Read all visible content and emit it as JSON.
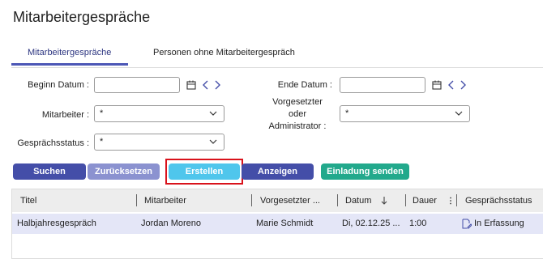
{
  "page": {
    "title": "Mitarbeitergespräche"
  },
  "tabs": [
    {
      "label": "Mitarbeitergespräche",
      "active": true
    },
    {
      "label": "Personen ohne Mitarbeitergespräch",
      "active": false
    }
  ],
  "filters": {
    "begin_date_label": "Beginn Datum :",
    "begin_date_value": "",
    "end_date_label": "Ende Datum :",
    "end_date_value": "",
    "employee_label": "Mitarbeiter :",
    "employee_value": "*",
    "supervisor_label_line1": "Vorgesetzter",
    "supervisor_label_line2": "oder",
    "supervisor_label_line3": "Administrator :",
    "supervisor_value": "*",
    "status_label": "Gesprächsstatus :",
    "status_value": "*"
  },
  "buttons": {
    "search": "Suchen",
    "reset": "Zurücksetzen",
    "create": "Erstellen",
    "show": "Anzeigen",
    "invite": "Einladung senden"
  },
  "table": {
    "columns": [
      "Titel",
      "Mitarbeiter",
      "Vorgesetzter ...",
      "Datum",
      "Dauer",
      "Gesprächsstatus"
    ],
    "rows": [
      {
        "title": "Halbjahresgespräch",
        "employee": "Jordan Moreno",
        "supervisor": "Marie Schmidt",
        "date": "Di, 02.12.25 ...",
        "duration": "1:00",
        "status": "In Erfassung"
      }
    ]
  },
  "colors": {
    "primary": "#444ea8",
    "primary_light": "#8b92d0",
    "cyan": "#4fc6ec",
    "green": "#22a98c",
    "highlight": "#d9121b",
    "row_selected": "#e4e6f7"
  }
}
